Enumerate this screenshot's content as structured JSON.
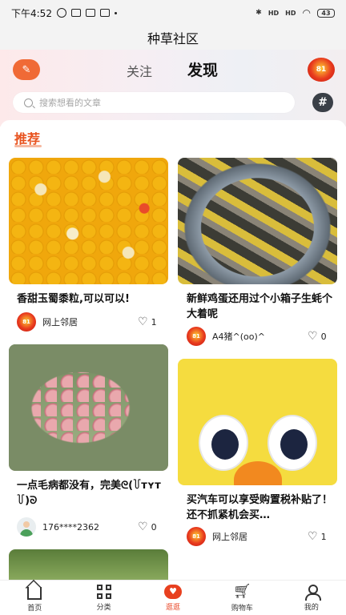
{
  "status_bar": {
    "time": "下午4:52",
    "battery": "43",
    "signal1": "HD",
    "signal2": "HD"
  },
  "app_title": "种草社区",
  "header": {
    "tab_follow": "关注",
    "tab_discover": "发现",
    "search_placeholder": "搜索想看的文章",
    "hash_label": "#",
    "avatar_badge": "81"
  },
  "section": {
    "title": "推荐"
  },
  "posts": [
    {
      "title": "香甜玉蜀黍粒,可以可以!",
      "author": "网上邻居",
      "likes": "1",
      "avatar_badge": "81"
    },
    {
      "title": "新鲜鸡蛋还用过个小箱子生蚝个大着呢",
      "author": "A4猪^(oo)^",
      "likes": "0",
      "avatar_badge": "81"
    },
    {
      "title": "一点毛病都没有，完美ᘓ(꒦ᴛʏᴛ꒦)ᘐ",
      "author": "176****2362",
      "likes": "0",
      "avatar_badge": ""
    },
    {
      "title": "买汽车可以享受购置税补贴了！还不抓紧机会买…",
      "author": "网上邻居",
      "likes": "1",
      "avatar_badge": "81"
    }
  ],
  "nav": {
    "home": "首页",
    "category": "分类",
    "browse": "逛逛",
    "cart": "购物车",
    "mine": "我的"
  },
  "colors": {
    "accent": "#e8401f",
    "section_title": "#e8531f",
    "edit_button": "#f06a36"
  }
}
